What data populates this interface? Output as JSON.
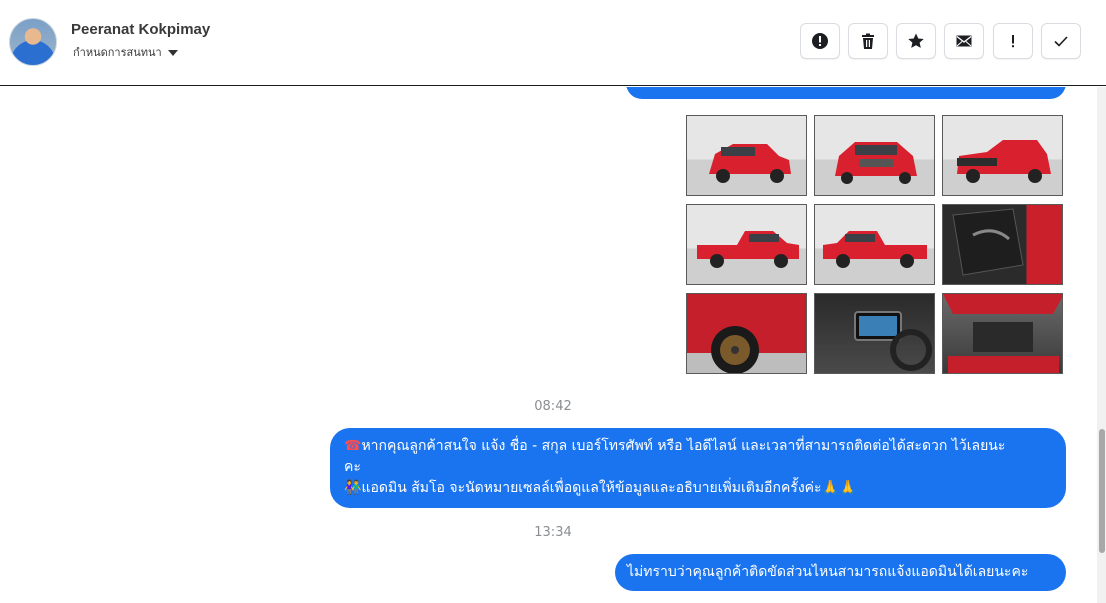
{
  "header": {
    "contact_name": "Peeranat Kokpimay",
    "conversation_setting": "กำหนดการสนทนา",
    "toolbar": [
      {
        "name": "report-button",
        "icon": "alert-circle-icon"
      },
      {
        "name": "delete-button",
        "icon": "trash-icon"
      },
      {
        "name": "star-button",
        "icon": "star-icon"
      },
      {
        "name": "mark-unread-button",
        "icon": "mail-icon"
      },
      {
        "name": "important-button",
        "icon": "exclamation-icon"
      },
      {
        "name": "done-button",
        "icon": "check-icon"
      }
    ]
  },
  "messages": {
    "photo_grid": [
      "front-three-quarter",
      "front",
      "rear-three-quarter",
      "side-left",
      "side-right",
      "door-interior",
      "wheel-closeup",
      "dashboard",
      "engine-bay"
    ],
    "timestamp_1": "08:42",
    "message_1_line1": "หากคุณลูกค้าสนใจ แจ้ง ชื่อ - สกุล เบอร์โทรศัพท์ หรือ ไอดีไลน์ และเวลาที่สามารถติดต่อได้สะดวก ไว้เลยนะ",
    "message_1_line2": "คะ",
    "message_1_line3": "แอดมิน ส้มโอ จะนัดหมายเซลล์เพื่อดูแลให้ข้อมูลและอธิบายเพิ่มเติมอีกครั้งค่ะ",
    "timestamp_2": "13:34",
    "message_2": "ไม่ทราบว่าคุณลูกค้าติดขัดส่วนไหนสามารถแจ้งแอดมินได้เลยนะคะ"
  },
  "colors": {
    "bubble": "#1b74ef",
    "timestamp": "#8a8d91",
    "car_red": "#d8202e"
  }
}
